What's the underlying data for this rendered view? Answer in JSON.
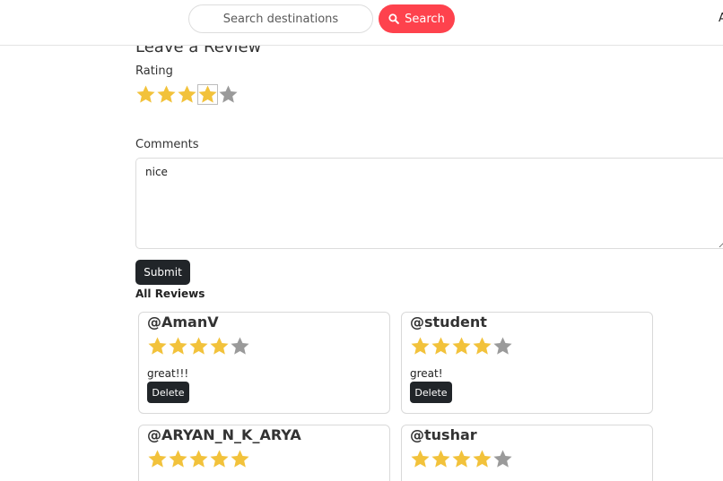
{
  "header": {
    "search_placeholder": "Search destinations",
    "search_button_label": "Search",
    "search_icon": "search-icon",
    "edge_text": "A"
  },
  "form": {
    "title": "Leave a Review",
    "rating_label": "Rating",
    "rating_value": 4,
    "rating_max": 5,
    "comments_label": "Comments",
    "comments_value": "nice",
    "submit_label": "Submit"
  },
  "reviews": {
    "heading": "All Reviews",
    "items": [
      {
        "author": "@AmanV",
        "rating": 4,
        "comment": "great!!!",
        "delete_label": "Delete"
      },
      {
        "author": "@student",
        "rating": 4,
        "comment": "great!",
        "delete_label": "Delete"
      },
      {
        "author": "@ARYAN_N_K_ARYA",
        "rating": 5,
        "comment": "",
        "delete_label": ""
      },
      {
        "author": "@tushar",
        "rating": 4,
        "comment": "",
        "delete_label": ""
      }
    ]
  },
  "colors": {
    "star_filled": "#f2c23b",
    "star_empty": "#9a9a9a",
    "accent": "#fe424d",
    "dark_button": "#212529"
  },
  "icons": {
    "star": "star-icon"
  }
}
